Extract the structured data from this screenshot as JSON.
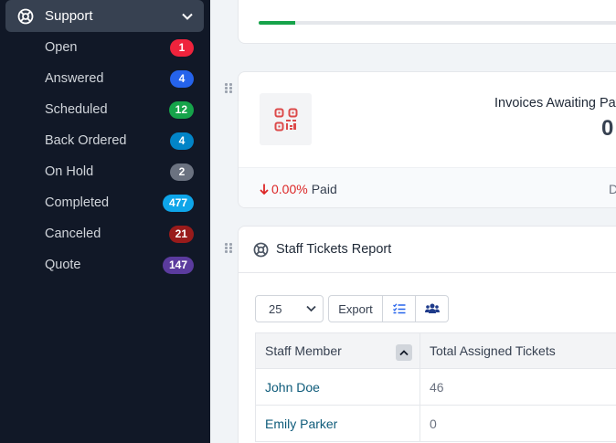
{
  "sidebar": {
    "section_label": "Support",
    "items": [
      {
        "label": "Open",
        "count": "1",
        "color": "#ef233c"
      },
      {
        "label": "Answered",
        "count": "4",
        "color": "#2563eb"
      },
      {
        "label": "Scheduled",
        "count": "12",
        "color": "#16a34a"
      },
      {
        "label": "Back Ordered",
        "count": "4",
        "color": "#0284c7"
      },
      {
        "label": "On Hold",
        "count": "2",
        "color": "#6b7280"
      },
      {
        "label": "Completed",
        "count": "477",
        "color": "#0ea5e9"
      },
      {
        "label": "Canceled",
        "count": "21",
        "color": "#991b1b"
      },
      {
        "label": "Quote",
        "count": "147",
        "color": "#5b3b9e"
      }
    ]
  },
  "progress": {
    "fraction": 0.1,
    "color": "#16a34a"
  },
  "invoices": {
    "title": "Invoices Awaiting Pay",
    "value": "0",
    "paid_percent": "0.00%",
    "paid_label": "Paid",
    "footer_right": "D"
  },
  "staff_report": {
    "title": "Staff Tickets Report",
    "page_size": "25",
    "export_label": "Export",
    "columns": [
      "Staff Member",
      "Total Assigned Tickets"
    ],
    "rows": [
      {
        "name": "John Doe",
        "total": "46"
      },
      {
        "name": "Emily Parker",
        "total": "0"
      }
    ]
  }
}
